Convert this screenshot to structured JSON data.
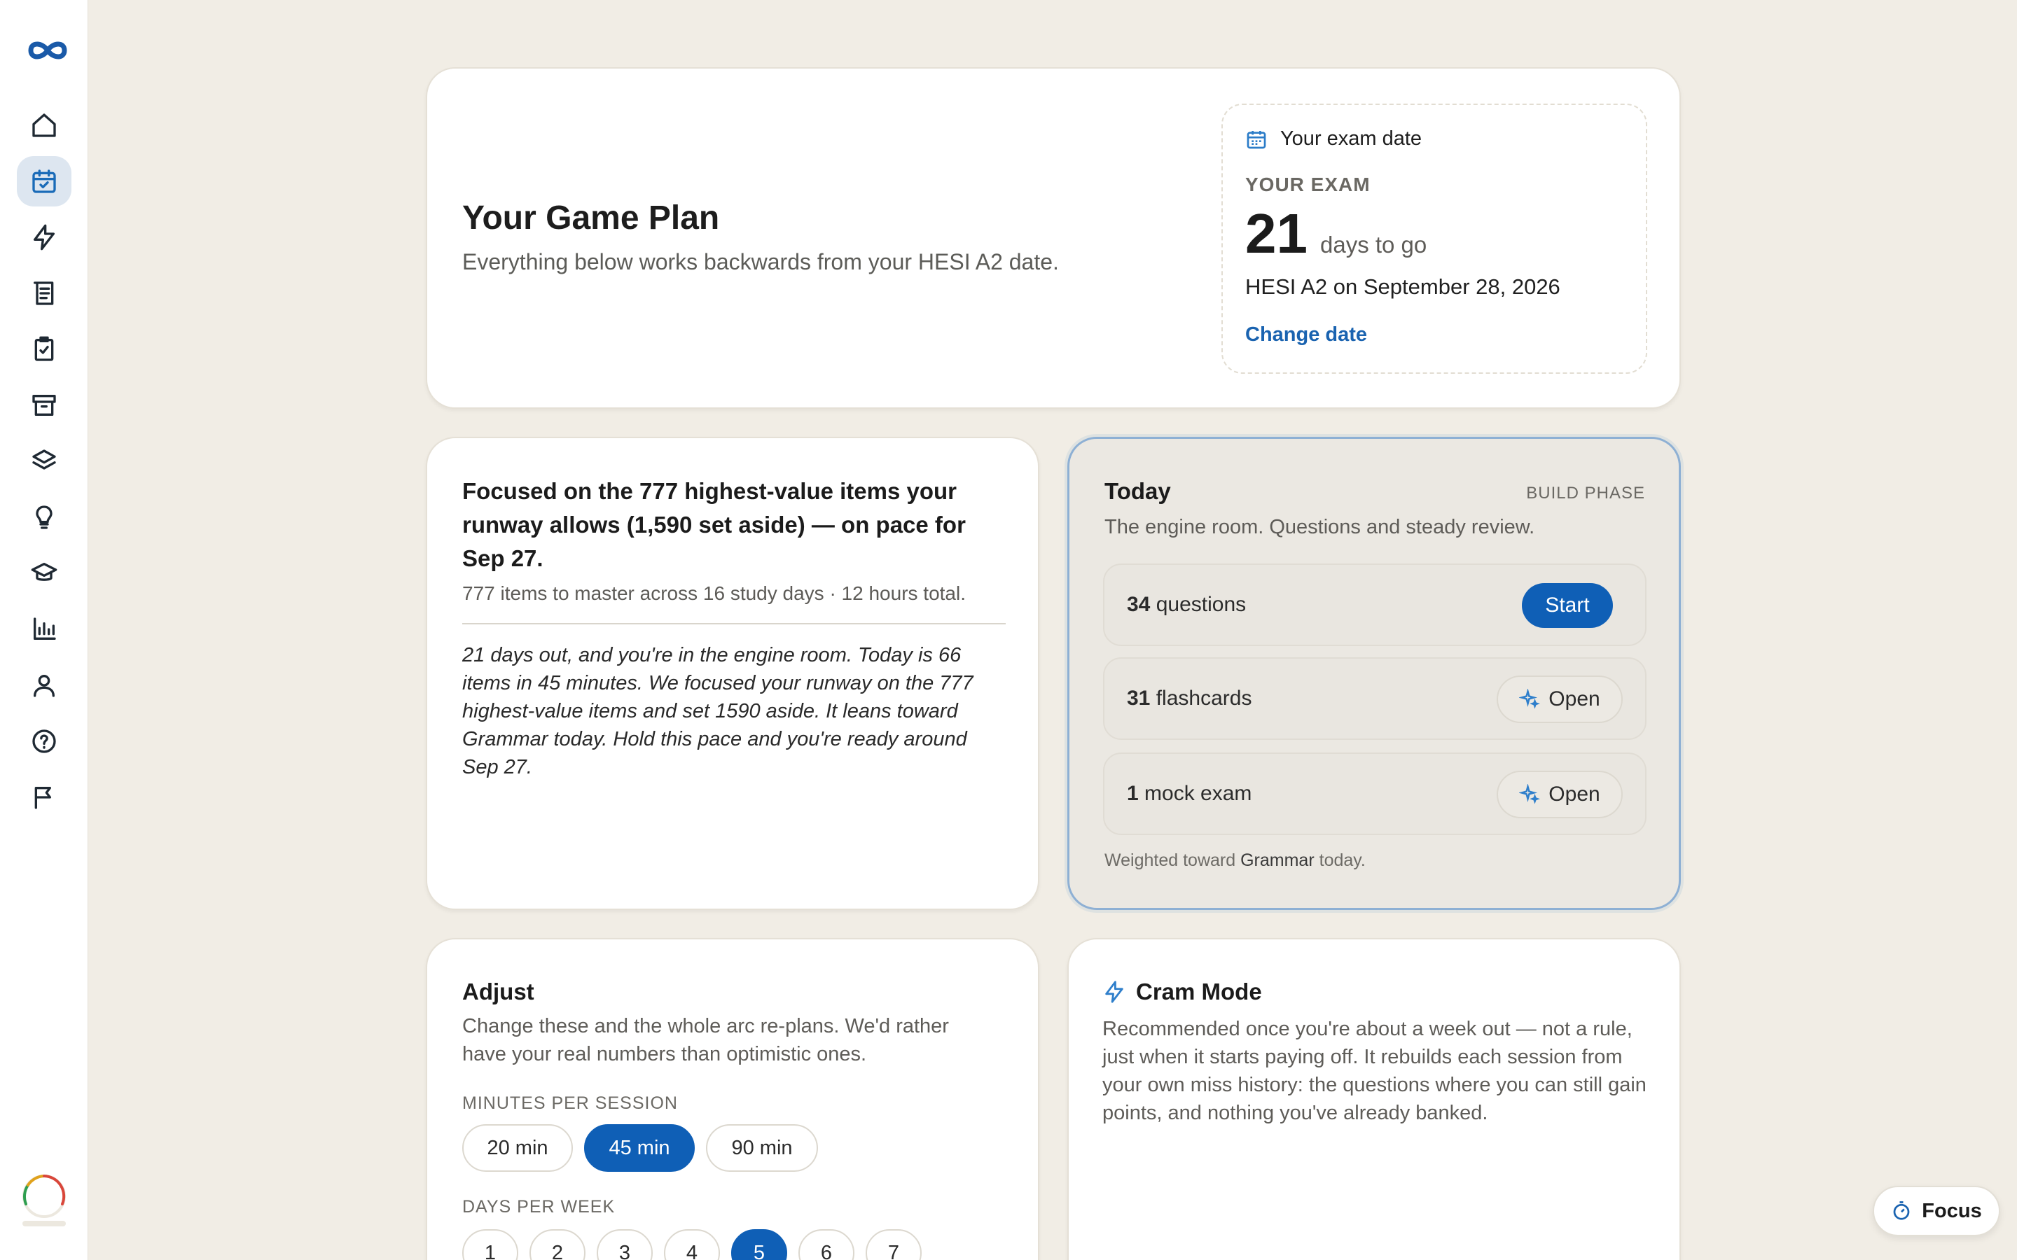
{
  "sidebar": {
    "items": [
      {
        "icon": "home-icon"
      },
      {
        "icon": "calendar-check-icon",
        "active": true
      },
      {
        "icon": "lightning-icon"
      },
      {
        "icon": "notes-icon"
      },
      {
        "icon": "clipboard-check-icon"
      },
      {
        "icon": "archive-icon"
      },
      {
        "icon": "layers-icon"
      },
      {
        "icon": "lightbulb-icon"
      },
      {
        "icon": "graduation-cap-icon"
      },
      {
        "icon": "bar-chart-icon"
      },
      {
        "icon": "user-icon"
      },
      {
        "icon": "help-icon"
      },
      {
        "icon": "flag-icon"
      }
    ]
  },
  "hero": {
    "title": "Your Game Plan",
    "subtitle": "Everything below works backwards from your HESI A2 date."
  },
  "exam": {
    "header": "Your exam date",
    "label": "YOUR EXAM",
    "days": "21",
    "days_text": "days to go",
    "on_date": "HESI A2 on September 28, 2026",
    "change_label": "Change date"
  },
  "focus": {
    "headline": "Focused on the 777 highest-value items your runway allows (1,590 set aside) — on pace for Sep 27.",
    "summary": "777 items to master across 16 study days · 12 hours total.",
    "narrative": "21 days out, and you're in the engine room. Today is 66 items in 45 minutes. We focused your runway on the 777 highest-value items and set 1590 aside. It leans toward Grammar today. Hold this pace and you're ready around Sep 27."
  },
  "today": {
    "title": "Today",
    "phase": "BUILD PHASE",
    "subtitle": "The engine room. Questions and steady review.",
    "tasks": [
      {
        "count": "34",
        "label": "questions",
        "action": "Start"
      },
      {
        "count": "31",
        "label": "flashcards",
        "action": "Open"
      },
      {
        "count": "1",
        "label": "mock exam",
        "action": "Open"
      }
    ],
    "footer_prefix": "Weighted toward",
    "footer_subject": "Grammar",
    "footer_suffix": "today."
  },
  "adjust": {
    "title": "Adjust",
    "subtitle": "Change these and the whole arc re-plans. We'd rather have your real numbers than optimistic ones.",
    "minutes_label": "MINUTES PER SESSION",
    "minutes_options": [
      "20 min",
      "45 min",
      "90 min"
    ],
    "minutes_selected": "45 min",
    "days_label": "DAYS PER WEEK",
    "days_options": [
      "1",
      "2",
      "3",
      "4",
      "5",
      "6",
      "7"
    ],
    "days_selected": "5"
  },
  "cram": {
    "title": "Cram Mode",
    "body": "Recommended once you're about a week out — not a rule, just when it starts paying off. It rebuilds each session from your own miss history: the questions where you can still gain points, and nothing you've already banked."
  },
  "focus_button": {
    "label": "Focus"
  },
  "colors": {
    "accent": "#0f5fb6",
    "background": "#f1ede5"
  }
}
